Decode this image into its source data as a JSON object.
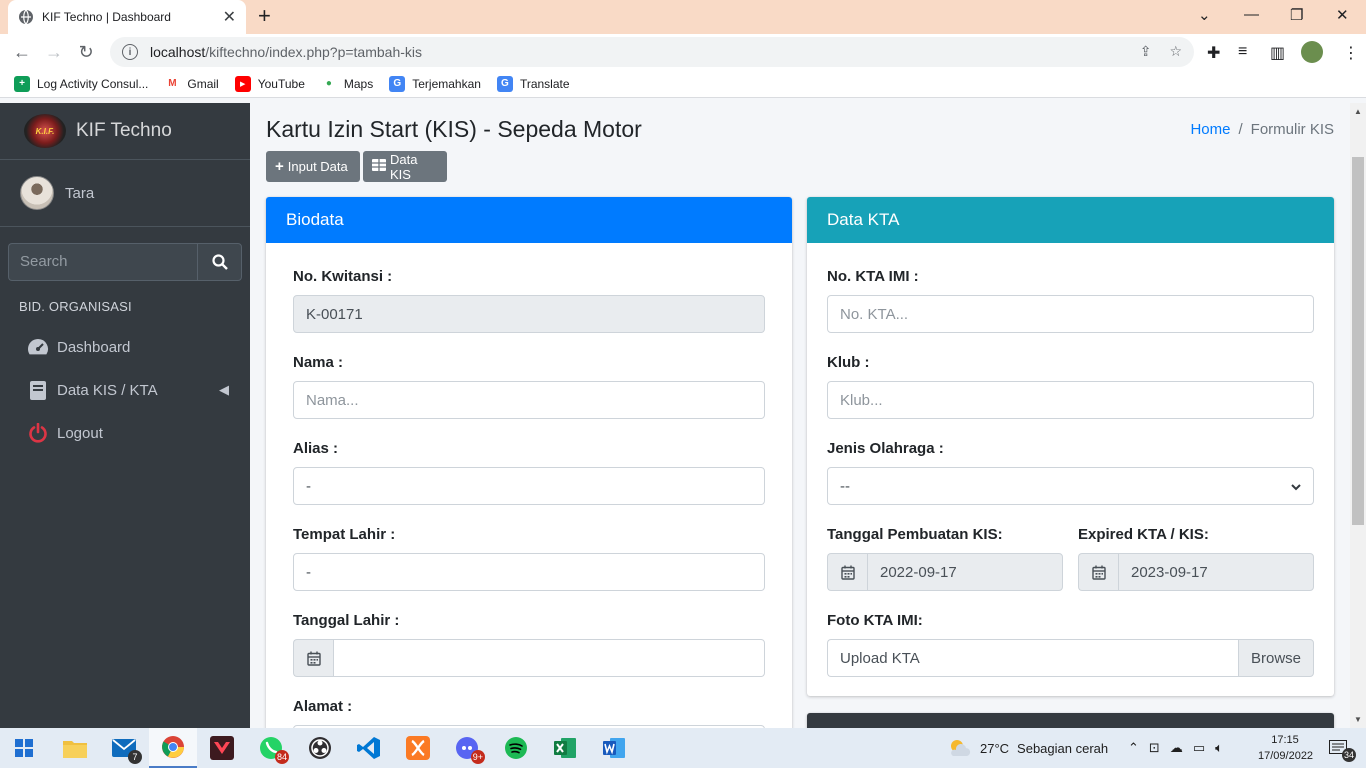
{
  "browser": {
    "tab_title": "KIF Techno | Dashboard",
    "url_host": "localhost",
    "url_path": "/kiftechno/index.php?p=tambah-kis",
    "bookmarks": [
      {
        "label": "Log Activity Consul...",
        "color": "#0f9d58",
        "glyph": "+"
      },
      {
        "label": "Gmail",
        "color": "#ea4335",
        "glyph": "M"
      },
      {
        "label": "YouTube",
        "color": "#ff0000",
        "glyph": "▶"
      },
      {
        "label": "Maps",
        "color": "#34a853",
        "glyph": "●"
      },
      {
        "label": "Terjemahkan",
        "color": "#4285f4",
        "glyph": "G"
      },
      {
        "label": "Translate",
        "color": "#4285f4",
        "glyph": "G"
      }
    ]
  },
  "sidebar": {
    "brand": "KIF Techno",
    "logo_text": "K.I.F.",
    "user": "Tara",
    "search_placeholder": "Search",
    "header": "BID. ORGANISASI",
    "items": [
      {
        "label": "Dashboard",
        "icon": "tachometer-icon"
      },
      {
        "label": "Data KIS / KTA",
        "icon": "book-icon"
      },
      {
        "label": "Logout",
        "icon": "power-icon"
      }
    ]
  },
  "page": {
    "title": "Kartu Izin Start (KIS) - Sepeda Motor",
    "breadcrumb_home": "Home",
    "breadcrumb_current": "Formulir KIS",
    "btn_input": "Input Data",
    "btn_data": "Data KIS"
  },
  "biodata": {
    "header": "Biodata",
    "header_color": "#007bff",
    "kwitansi_label": "No. Kwitansi :",
    "kwitansi_value": "K-00171",
    "nama_label": "Nama :",
    "nama_placeholder": "Nama...",
    "alias_label": "Alias :",
    "alias_value": "-",
    "tempat_label": "Tempat Lahir :",
    "tempat_value": "-",
    "tanggal_label": "Tanggal Lahir :",
    "tanggal_value": "",
    "alamat_label": "Alamat :"
  },
  "kta": {
    "header": "Data KTA",
    "header_color": "#17a2b8",
    "no_label": "No. KTA IMI :",
    "no_placeholder": "No. KTA...",
    "klub_label": "Klub :",
    "klub_placeholder": "Klub...",
    "jenis_label": "Jenis Olahraga :",
    "jenis_value": "--",
    "pembuatan_label": "Tanggal Pembuatan KIS:",
    "pembuatan_value": "2022-09-17",
    "expired_label": "Expired KTA / KIS:",
    "expired_value": "2023-09-17",
    "foto_label": "Foto KTA IMI:",
    "foto_value": "Upload KTA",
    "browse_label": "Browse"
  },
  "taskbar": {
    "weather_temp": "27°C",
    "weather_text": "Sebagian cerah",
    "time": "17:15",
    "date": "17/09/2022",
    "mail_badge": "7",
    "whatsapp_badge": "84",
    "discord_badge": "9+",
    "notif_badge": "34"
  }
}
